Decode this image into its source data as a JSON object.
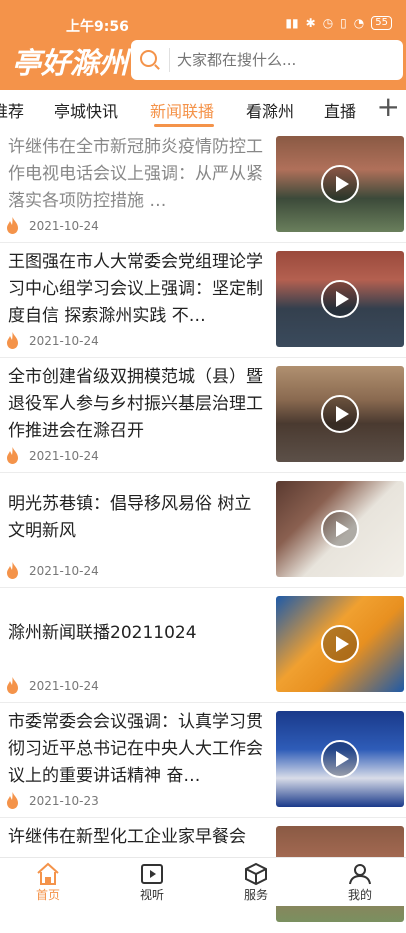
{
  "status_bar": {
    "time": "上午9:56",
    "battery": "55"
  },
  "header": {
    "logo": "亭好滁州",
    "search_placeholder": "大家都在搜什么..."
  },
  "tabs": [
    {
      "label": "推荐"
    },
    {
      "label": "亭城快讯"
    },
    {
      "label": "新闻联播",
      "active": true
    },
    {
      "label": "看滁州"
    },
    {
      "label": "直播"
    }
  ],
  "news": [
    {
      "title": "许继伟在全市新冠肺炎疫情防控工作电视电话会议上强调：从严从紧落实各项防控措施 …",
      "date": "2021-10-24",
      "read": true
    },
    {
      "title": "王图强在市人大常委会党组理论学习中心组学习会议上强调：坚定制度自信 探索滁州实践 不…",
      "date": "2021-10-24",
      "read": false
    },
    {
      "title": "全市创建省级双拥模范城（县）暨退役军人参与乡村振兴基层治理工作推进会在滁召开",
      "date": "2021-10-24",
      "read": false
    },
    {
      "title": "明光苏巷镇：倡导移风易俗 树立文明新风",
      "date": "2021-10-24",
      "read": false
    },
    {
      "title": "滁州新闻联播20211024",
      "date": "2021-10-24",
      "read": false
    },
    {
      "title": "市委常委会会议强调：认真学习贯彻习近平总书记在中央人大工作会议上的重要讲话精神 奋…",
      "date": "2021-10-23",
      "read": false
    },
    {
      "title": "许继伟在新型化工企业家早餐会",
      "date": "",
      "read": false
    }
  ],
  "bottom_nav": [
    {
      "label": "首页",
      "active": true
    },
    {
      "label": "视听"
    },
    {
      "label": "服务"
    },
    {
      "label": "我的"
    }
  ],
  "colors": {
    "accent": "#f4934a"
  }
}
